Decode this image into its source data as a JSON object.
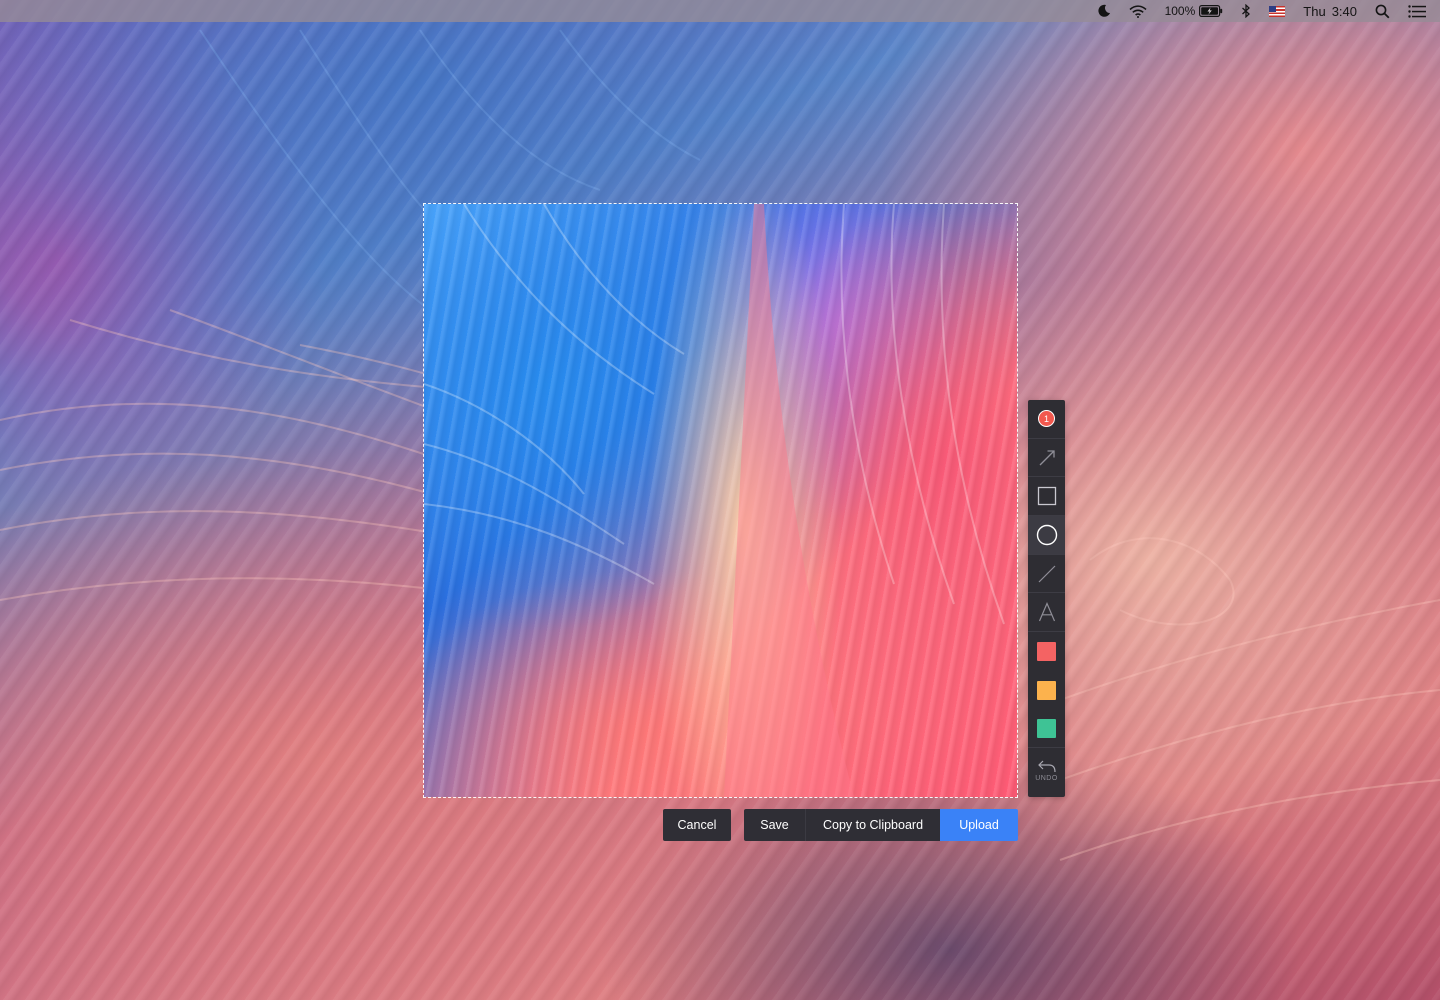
{
  "menubar": {
    "battery_pct": "100%",
    "day": "Thu",
    "time": "3:40",
    "icons": [
      "moon-icon",
      "wifi-icon",
      "battery-charging-icon",
      "bluetooth-icon",
      "us-flag-icon",
      "spotlight-search-icon",
      "notification-center-icon"
    ]
  },
  "toolbar": {
    "counter_value": "1",
    "tools": [
      "counter",
      "arrow",
      "rectangle",
      "ellipse",
      "line",
      "text"
    ],
    "active_tool": "ellipse",
    "colors": [
      "#f46363",
      "#fcb24d",
      "#3ec395"
    ],
    "undo_label": "UNDO"
  },
  "actions": {
    "cancel_label": "Cancel",
    "save_label": "Save",
    "copy_label": "Copy to Clipboard",
    "upload_label": "Upload"
  },
  "colors": {
    "accent": "#3a82f7",
    "toolbar_bg": "#2e2d33",
    "badge": "#f2584e"
  }
}
